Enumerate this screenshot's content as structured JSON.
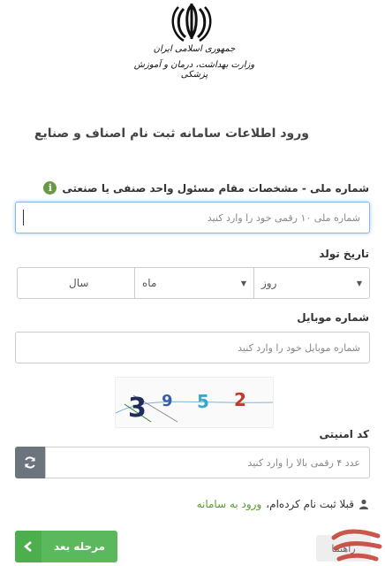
{
  "logo": {
    "line1": "جمهوری اسلامی ایران",
    "line2": "وزارت بهداشت، درمان و آموزش پزشکی"
  },
  "page_title": "ورود اطلاعات سامانه ثبت نام اصناف و صنایع",
  "national_id": {
    "label": "شماره ملی - مشخصات مقام مسئول واحد صنفی یا صنعتی",
    "placeholder": "شماره ملی ۱۰ رقمی خود را وارد کنید"
  },
  "birth_date": {
    "label": "تاریخ تولد",
    "day": "روز",
    "month": "ماه",
    "year": "سال"
  },
  "mobile": {
    "label": "شماره موبایل",
    "placeholder": "شماره موبایل خود را وارد کنید"
  },
  "captcha": {
    "digits": [
      "3",
      "9",
      "5",
      "2"
    ],
    "colors": [
      "#1f2d5a",
      "#3b5ea8",
      "#3aa7c9",
      "#c0392b"
    ]
  },
  "security_code": {
    "label": "کد امنیتی",
    "placeholder": "عدد ۴ رقمی بالا را وارد کنید"
  },
  "already_registered": {
    "text": "قبلا ثبت نام کرده‌ام،",
    "link": "ورود به سامانه"
  },
  "next_button": {
    "label": "مرحله بعد"
  },
  "help_button": {
    "label": "راهنما"
  },
  "colors": {
    "accent_green": "#5cb85c",
    "link_green": "#5b9a2f",
    "focus_blue": "#8fb8e6",
    "refresh_gray": "#6c757d"
  }
}
